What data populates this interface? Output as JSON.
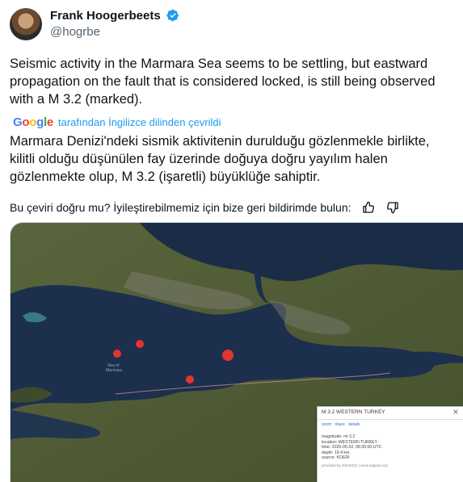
{
  "author": {
    "name": "Frank Hoogerbeets",
    "handle": "@hogrbe",
    "verified": true
  },
  "tweet": {
    "text": "Seismic activity in the Marmara Sea seems to be settling, but eastward\npropagation on the fault that is considered locked, is still being observed\nwith a M 3.2 (marked)."
  },
  "translation": {
    "provider_logo": "Google",
    "provider_text": "tarafından İngilizce dilinden çevrildi",
    "text": "Marmara Denizi'ndeki sismik aktivitenin durulduğu gözlenmekle birlikte,\nkilitli olduğu düşünülen fay üzerinde doğuya doğru yayılım halen\ngözlenmekte olup, M 3.2 (işaretli) büyüklüğe sahiptir.",
    "feedback_prompt": "Bu çeviri doğru mu? İyileştirebilmemiz için bize geri bildirimde bulun:"
  },
  "map": {
    "sea_label": "Sea of\nMarmara",
    "events_count": 4
  },
  "info_popup": {
    "title": "M 3.2 WESTERN TURKEY",
    "links": [
      "zoom",
      "share",
      "details"
    ],
    "lines": [
      "magnitude: ml 3.2",
      "location: WESTERN TURKEY",
      "time: 2025-05-02, 08:30:00 UTC",
      "depth: 19.4 km.",
      "source: KOERI"
    ],
    "footer": "provided by SSGEOS | www.ssgeos.org"
  },
  "colors": {
    "link": "#1d9bf0",
    "verified": "#1d9bf0",
    "quake": "#e3342f",
    "sea": "#1c2f4d",
    "land": "#4e5a35"
  },
  "icons": [
    "verified-badge-icon",
    "thumbs-up-icon",
    "thumbs-down-icon",
    "close-icon"
  ]
}
